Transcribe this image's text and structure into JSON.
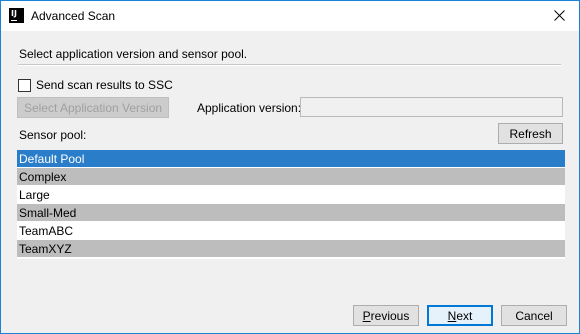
{
  "window": {
    "title": "Advanced Scan",
    "app_icon_text": "IJ",
    "close_glyph": "✕"
  },
  "dialog": {
    "prompt": "Select application version and sensor pool.",
    "send_results_label": "Send scan results to SSC",
    "send_results_checked": false,
    "select_app_version_button": "Select Application Version",
    "app_version_label": "Application version:",
    "app_version_value": "",
    "sensor_pool_label": "Sensor pool:",
    "refresh_button": "Refresh",
    "sensor_pools": [
      "Default Pool",
      "Complex",
      "Large",
      "Small-Med",
      "TeamABC",
      "TeamXYZ"
    ],
    "selected_pool_index": 0
  },
  "footer": {
    "previous_mnemonic": "P",
    "previous_rest": "revious",
    "next_mnemonic": "N",
    "next_rest": "ext",
    "cancel_button": "Cancel"
  },
  "colors": {
    "selection": "#2a7dc9",
    "alt_row": "#bdbdbd",
    "window_border": "#1883d7"
  }
}
